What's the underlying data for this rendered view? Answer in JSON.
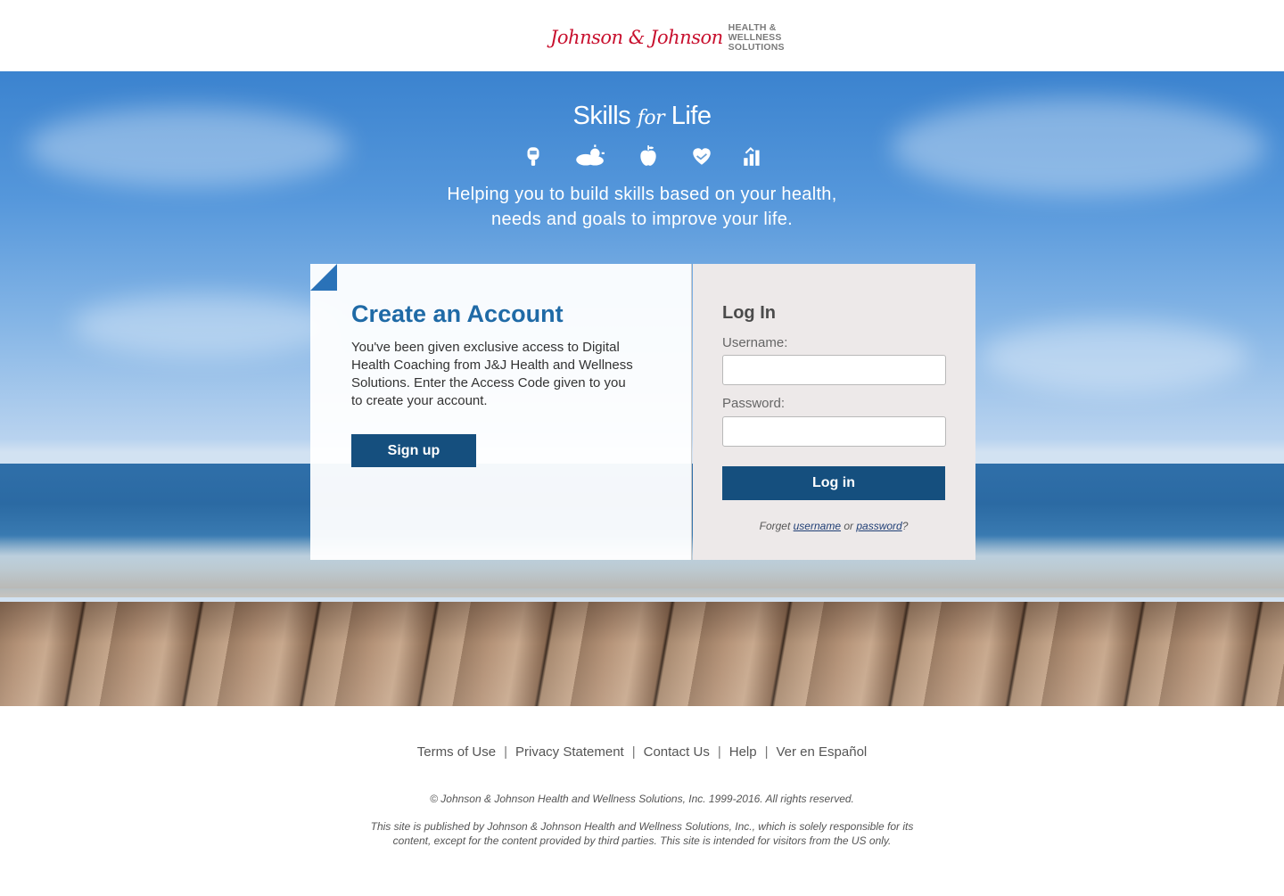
{
  "header": {
    "logo_script": "Johnson & Johnson",
    "logo_script_amp": "&",
    "logo_sub": [
      "HEALTH &",
      "WELLNESS",
      "SOLUTIONS"
    ]
  },
  "hero": {
    "brand_skills": "Skills",
    "brand_for": "for",
    "brand_life": "Life",
    "tagline_line1": "Helping you to build skills based on your health,",
    "tagline_line2": "needs and goals to improve your life.",
    "icons": [
      "glucose-meter-icon",
      "weather-icon",
      "apple-icon",
      "heart-hands-icon",
      "progress-chart-icon"
    ]
  },
  "create": {
    "title": "Create an Account",
    "text_lines": [
      "You've been given exclusive access to Digital",
      "Health Coaching from J&J Health and Wellness",
      "Solutions.  Enter the Access Code given to you",
      "to create your account."
    ],
    "signup_label": "Sign up"
  },
  "login": {
    "title": "Log In",
    "username_label": "Username:",
    "password_label": "Password:",
    "username_value": "",
    "password_value": "",
    "login_label": "Log in",
    "forgot_prefix": "Forget ",
    "forgot_username": "username",
    "forgot_or": " or ",
    "forgot_password": "password",
    "forgot_suffix": "?"
  },
  "footer": {
    "links": [
      "Terms of Use",
      "Privacy Statement",
      "Contact Us",
      "Help",
      "Ver en Español"
    ],
    "separator": "|",
    "copyright": "© Johnson & Johnson Health and Wellness Solutions, Inc. 1999-2016. All rights reserved.",
    "disclaimer_line1": "This site is published by Johnson & Johnson Health and Wellness Solutions, Inc., which is solely responsible for its",
    "disclaimer_line2": "content, except for the content provided by third parties.  This site is intended for visitors from the US only."
  },
  "colors": {
    "accent_blue": "#1f6aa6",
    "button_blue": "#154f7e",
    "brand_red": "#c8102e"
  }
}
